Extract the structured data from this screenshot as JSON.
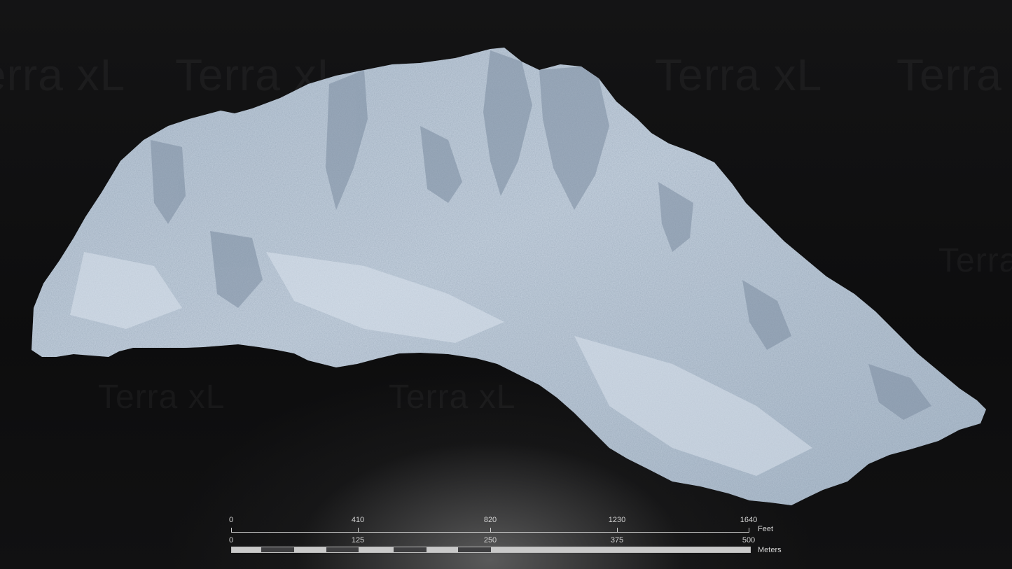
{
  "watermark_text": "Terra xL",
  "scale_bar": {
    "feet": {
      "ticks": [
        "0",
        "410",
        "820",
        "1230",
        "1640"
      ],
      "unit": "Feet"
    },
    "meters": {
      "ticks": [
        "0",
        "125",
        "250",
        "375",
        "500"
      ],
      "unit": "Meters"
    }
  },
  "colors": {
    "background": "#0b0b0c",
    "terrain_light": "#c3d0de",
    "terrain_shadow": "#6d7f94",
    "scale_text": "#d4d4d4"
  }
}
